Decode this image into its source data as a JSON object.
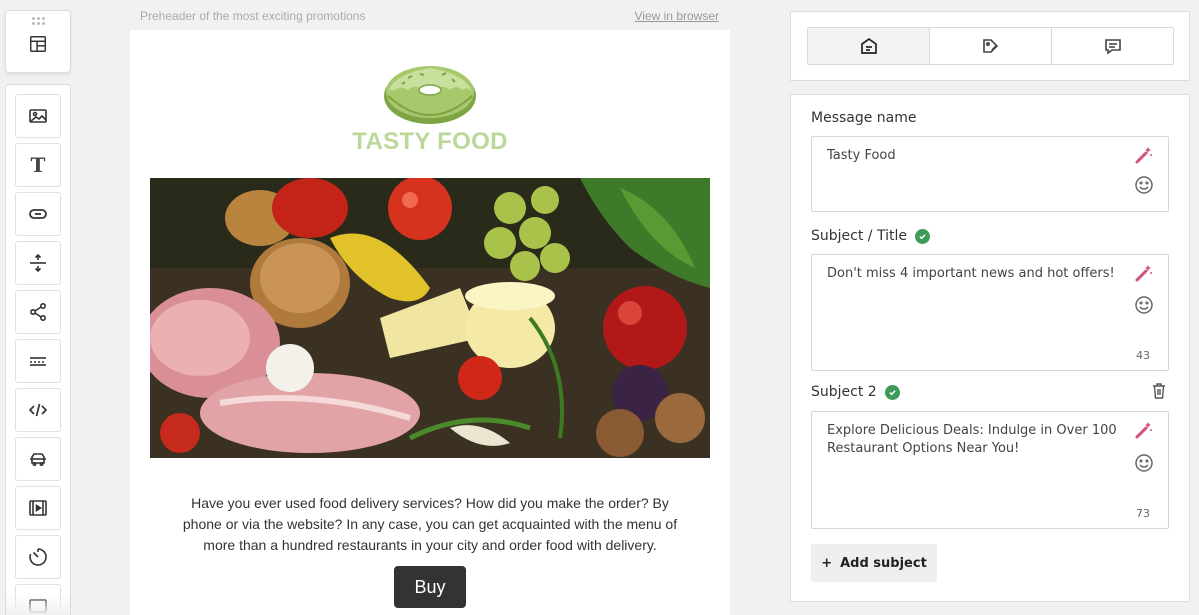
{
  "toolbar": {
    "top_tool": "layout-blocks-icon",
    "tools": [
      "image-icon",
      "text-icon",
      "button-icon",
      "spacer-icon",
      "social-icon",
      "divider-icon",
      "html-code-icon",
      "menu-icon",
      "video-icon",
      "timer-icon"
    ]
  },
  "email": {
    "preheader": "Preheader of the most exciting promotions",
    "view_in_browser": "View in browser",
    "brand_name": "TASTY FOOD",
    "body_text": "Have you ever used food delivery services? How did you make the order? By phone or via the website? In any case, you can get acquainted with the menu of more than a hundred restaurants in your city and order food with delivery.",
    "cta_label": "Buy"
  },
  "panel": {
    "tabs": [
      {
        "icon": "email-settings-icon",
        "active": true
      },
      {
        "icon": "tags-icon",
        "active": false
      },
      {
        "icon": "message-icon",
        "active": false
      }
    ],
    "message_name": {
      "label": "Message name",
      "value": "Tasty Food"
    },
    "subject_title": {
      "label": "Subject / Title",
      "value": "Don't miss 4 important news and hot offers!",
      "count": "43"
    },
    "subject_2": {
      "label": "Subject 2",
      "value": "Explore Delicious Deals: Indulge in Over 100 Restaurant Options Near You!",
      "count": "73"
    },
    "add_subject": "Add subject"
  },
  "colors": {
    "brand_green": "#bcd79a",
    "check_green": "#3d9c5a",
    "wand_pink": "#d2527f",
    "button_dark": "#333333"
  }
}
